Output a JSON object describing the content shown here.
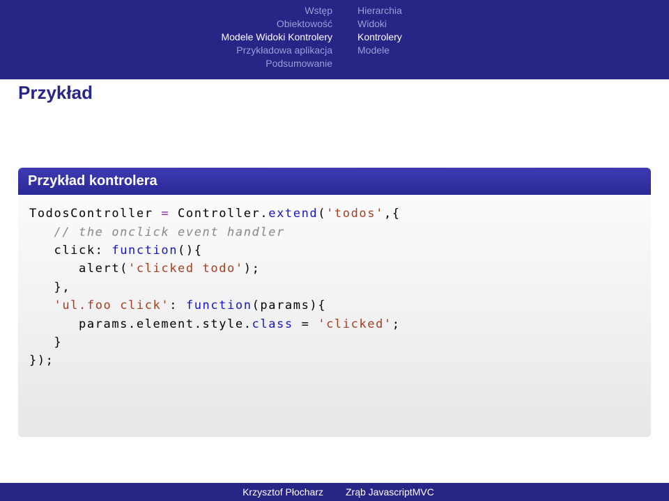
{
  "nav_left": {
    "l1": "Wstęp",
    "l2": "Obiektowość",
    "l3": "Modele Widoki Kontrolery",
    "l4": "Przykładowa aplikacja",
    "l5": "Podsumowanie"
  },
  "nav_right": {
    "r1": "Hierarchia",
    "r2": "Widoki",
    "r3": "Kontrolery",
    "r4": "Modele"
  },
  "frametitle": "Przykład",
  "block_title": "Przykład kontrolera",
  "code": {
    "l1a": "TodosController ",
    "l1b": "= ",
    "l1c": "Controller",
    "l1d": ".",
    "l1e": "extend",
    "l1f": "(",
    "l1g": "'todos'",
    "l1h": ",{",
    "l2": "   // the onclick event handler",
    "l3a": "   click: ",
    "l3b": "function",
    "l3c": "(){",
    "l4a": "      alert(",
    "l4b": "'clicked todo'",
    "l4c": ");",
    "l5": "   },",
    "l6a": "   ",
    "l6b": "'ul.foo click'",
    "l6c": ": ",
    "l6d": "function",
    "l6e": "(params){",
    "l7a": "      params.element.style.",
    "l7b": "class",
    "l7c": " = ",
    "l7d": "'clicked'",
    "l7e": ";",
    "l8": "   }",
    "l9": "});"
  },
  "footer": {
    "left": "Krzysztof Płocharz",
    "right": "Zrąb JavascriptMVC"
  }
}
